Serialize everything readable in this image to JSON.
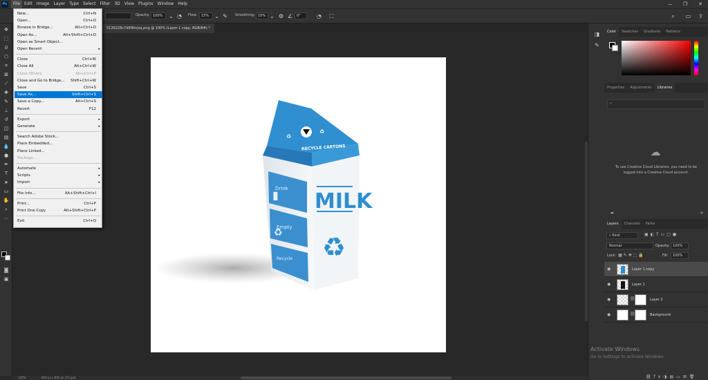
{
  "app": {
    "logo": "Ps",
    "menus": [
      "File",
      "Edit",
      "Image",
      "Layer",
      "Type",
      "Select",
      "Filter",
      "3D",
      "View",
      "Plugins",
      "Window",
      "Help"
    ],
    "window_controls": [
      "—",
      "❐",
      "✕"
    ]
  },
  "options_bar": {
    "opacity_label": "Opacity:",
    "opacity_value": "100%",
    "flow_label": "Flow:",
    "flow_value": "15%",
    "smoothing_label": "Smoothing:",
    "smoothing_value": "10%",
    "angle_value": "0°"
  },
  "document": {
    "tab_title": "5126228c7d6f8mjsq.png @ 100% (Layer 1 copy, RGB/8#) *",
    "status_zoom": "100%",
    "status_size": "800 px x 800 px (72 ppi)"
  },
  "product": {
    "brand_label": "RECYCLE CARTONS",
    "main_text": "MILK",
    "side_texts": [
      "Drink",
      "Empty",
      "Recycle"
    ],
    "colors": {
      "carton_blue": "#2f8fd0",
      "carton_white": "#eef2f5",
      "dark_blue": "#1d6fae"
    }
  },
  "file_menu": {
    "items": [
      {
        "label": "New...",
        "shortcut": "Ctrl+N"
      },
      {
        "label": "Open...",
        "shortcut": "Ctrl+O"
      },
      {
        "label": "Browse in Bridge...",
        "shortcut": "Alt+Ctrl+O"
      },
      {
        "label": "Open As...",
        "shortcut": "Alt+Shift+Ctrl+O"
      },
      {
        "label": "Open as Smart Object...",
        "shortcut": ""
      },
      {
        "label": "Open Recent",
        "shortcut": "",
        "submenu": true
      },
      {
        "separator": true
      },
      {
        "label": "Close",
        "shortcut": "Ctrl+W"
      },
      {
        "label": "Close All",
        "shortcut": "Alt+Ctrl+W"
      },
      {
        "label": "Close Others",
        "shortcut": "Alt+Ctrl+P",
        "disabled": true
      },
      {
        "label": "Close and Go to Bridge...",
        "shortcut": "Shift+Ctrl+W"
      },
      {
        "label": "Save",
        "shortcut": "Ctrl+S"
      },
      {
        "label": "Save As...",
        "shortcut": "Shift+Ctrl+S",
        "highlighted": true
      },
      {
        "label": "Save a Copy...",
        "shortcut": "Alt+Ctrl+S"
      },
      {
        "label": "Revert",
        "shortcut": "F12"
      },
      {
        "separator": true
      },
      {
        "label": "Export",
        "shortcut": "",
        "submenu": true
      },
      {
        "label": "Generate",
        "shortcut": "",
        "submenu": true
      },
      {
        "separator": true
      },
      {
        "label": "Search Adobe Stock...",
        "shortcut": ""
      },
      {
        "label": "Place Embedded...",
        "shortcut": ""
      },
      {
        "label": "Place Linked...",
        "shortcut": ""
      },
      {
        "label": "Package...",
        "shortcut": "",
        "disabled": true
      },
      {
        "separator": true
      },
      {
        "label": "Automate",
        "shortcut": "",
        "submenu": true
      },
      {
        "label": "Scripts",
        "shortcut": "",
        "submenu": true
      },
      {
        "label": "Import",
        "shortcut": "",
        "submenu": true
      },
      {
        "separator": true
      },
      {
        "label": "File Info...",
        "shortcut": "Alt+Shift+Ctrl+I"
      },
      {
        "separator": true
      },
      {
        "label": "Print...",
        "shortcut": "Ctrl+P"
      },
      {
        "label": "Print One Copy",
        "shortcut": "Alt+Shift+Ctrl+P"
      },
      {
        "separator": true
      },
      {
        "label": "Exit",
        "shortcut": "Ctrl+Q"
      }
    ]
  },
  "panels": {
    "color_tabs": [
      "Color",
      "Swatches",
      "Gradients",
      "Patterns"
    ],
    "props_tabs": [
      "Properties",
      "Adjustments",
      "Libraries"
    ],
    "library_message": "To use Creative Cloud Libraries, you need to be logged into a Creative Cloud account.",
    "layer_tabs": [
      "Layers",
      "Channels",
      "Paths"
    ],
    "filter_kind": "Kind",
    "blend_mode": "Normal",
    "opacity_label": "Opacity:",
    "opacity_value": "100%",
    "lock_label": "Lock:",
    "fill_label": "Fill:",
    "fill_value": "100%",
    "layers": [
      {
        "name": "Layer 1 copy",
        "selected": true
      },
      {
        "name": "Layer 1",
        "selected": false
      },
      {
        "name": "Layer 2",
        "selected": false,
        "mask": true
      },
      {
        "name": "Background",
        "selected": false,
        "mask": true
      }
    ]
  },
  "watermark": {
    "title": "Activate Windows",
    "subtitle": "Go to Settings to activate Windows."
  }
}
